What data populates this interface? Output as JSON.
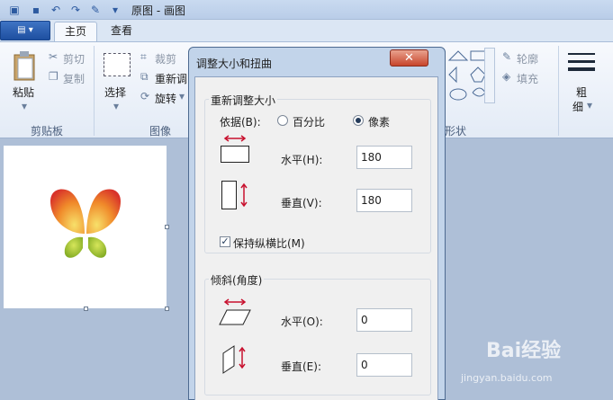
{
  "window": {
    "title": "原图 - 画图"
  },
  "quick_access": {
    "save_icon": "save-icon",
    "undo_icon": "undo-icon",
    "redo_icon": "redo-icon",
    "pen_icon": "pen-icon"
  },
  "ribbon_tabs": [
    {
      "label": "主页",
      "active": true
    },
    {
      "label": "查看",
      "active": false
    }
  ],
  "ribbon": {
    "clipboard": {
      "paste": "粘贴",
      "cut": "剪切",
      "copy": "复制",
      "group": "剪贴板"
    },
    "image": {
      "select": "选择",
      "crop": "裁剪",
      "resize": "重新调",
      "rotate": "旋转",
      "group": "图像"
    },
    "shapes": {
      "group": "形状",
      "outline": "轮廓",
      "fill": "填充"
    },
    "size": {
      "label_top": "粗",
      "label_bottom": "细"
    }
  },
  "dialog": {
    "title": "调整大小和扭曲",
    "close_symbol": "✕",
    "resize": {
      "legend": "重新调整大小",
      "by_label": "依据(B):",
      "percent_label": "百分比",
      "pixel_label": "像素",
      "selected": "pixels",
      "horizontal_label": "水平(H):",
      "horizontal_value": "180",
      "vertical_label": "垂直(V):",
      "vertical_value": "180",
      "keep_ratio_label": "保持纵横比(M)",
      "keep_ratio_checked": true
    },
    "skew": {
      "legend": "倾斜(角度)",
      "horizontal_label": "水平(O):",
      "horizontal_value": "0",
      "vertical_label": "垂直(E):",
      "vertical_value": "0"
    }
  },
  "watermark": {
    "logo_text": "Bai经验",
    "url": "jingyan.baidu.com"
  },
  "colors": {
    "accent": "#1e4fa0",
    "dialog_frame": "#c2d4ea",
    "close_button": "#c7452c",
    "arrow_red": "#c8102e"
  }
}
